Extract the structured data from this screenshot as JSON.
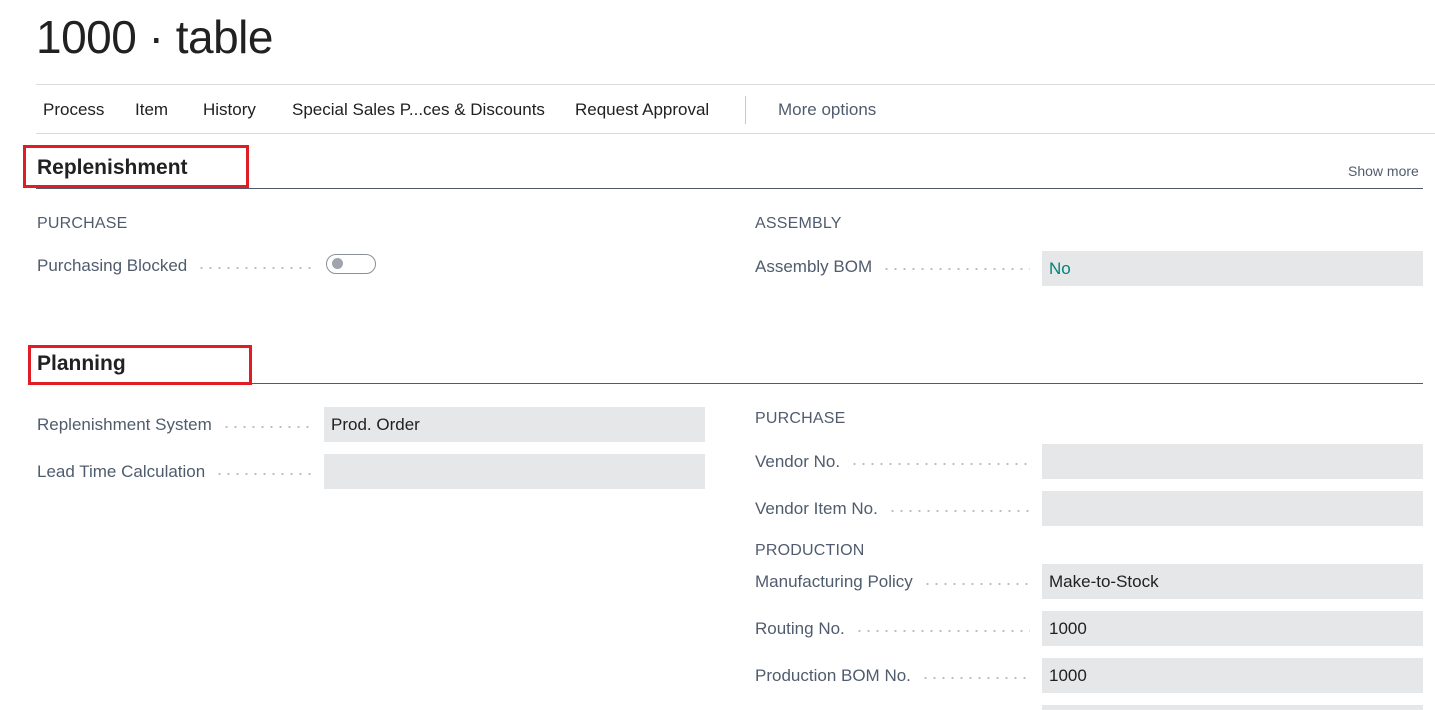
{
  "page": {
    "title": "1000 · table"
  },
  "actions": {
    "process": "Process",
    "item": "Item",
    "history": "History",
    "special_sales": "Special Sales P...ces & Discounts",
    "request_approval": "Request Approval",
    "more_options": "More options"
  },
  "replenishment": {
    "title": "Replenishment",
    "show_more": "Show more",
    "purchase_caption": "PURCHASE",
    "purchasing_blocked_label": "Purchasing Blocked",
    "purchasing_blocked_value": false,
    "assembly_caption": "ASSEMBLY",
    "assembly_bom_label": "Assembly BOM",
    "assembly_bom_value": "No"
  },
  "planning": {
    "title": "Planning",
    "replenishment_system_label": "Replenishment System",
    "replenishment_system_value": "Prod. Order",
    "lead_time_label": "Lead Time Calculation",
    "lead_time_value": "",
    "purchase_caption": "PURCHASE",
    "vendor_no_label": "Vendor No.",
    "vendor_no_value": "",
    "vendor_item_no_label": "Vendor Item No.",
    "vendor_item_no_value": "",
    "production_caption": "PRODUCTION",
    "manufacturing_policy_label": "Manufacturing Policy",
    "manufacturing_policy_value": "Make-to-Stock",
    "routing_no_label": "Routing No.",
    "routing_no_value": "1000",
    "production_bom_label": "Production BOM No.",
    "production_bom_value": "1000"
  },
  "colors": {
    "highlight_box": "#e01c24",
    "link_value": "#00837a",
    "field_bg": "#e6e7e9"
  }
}
